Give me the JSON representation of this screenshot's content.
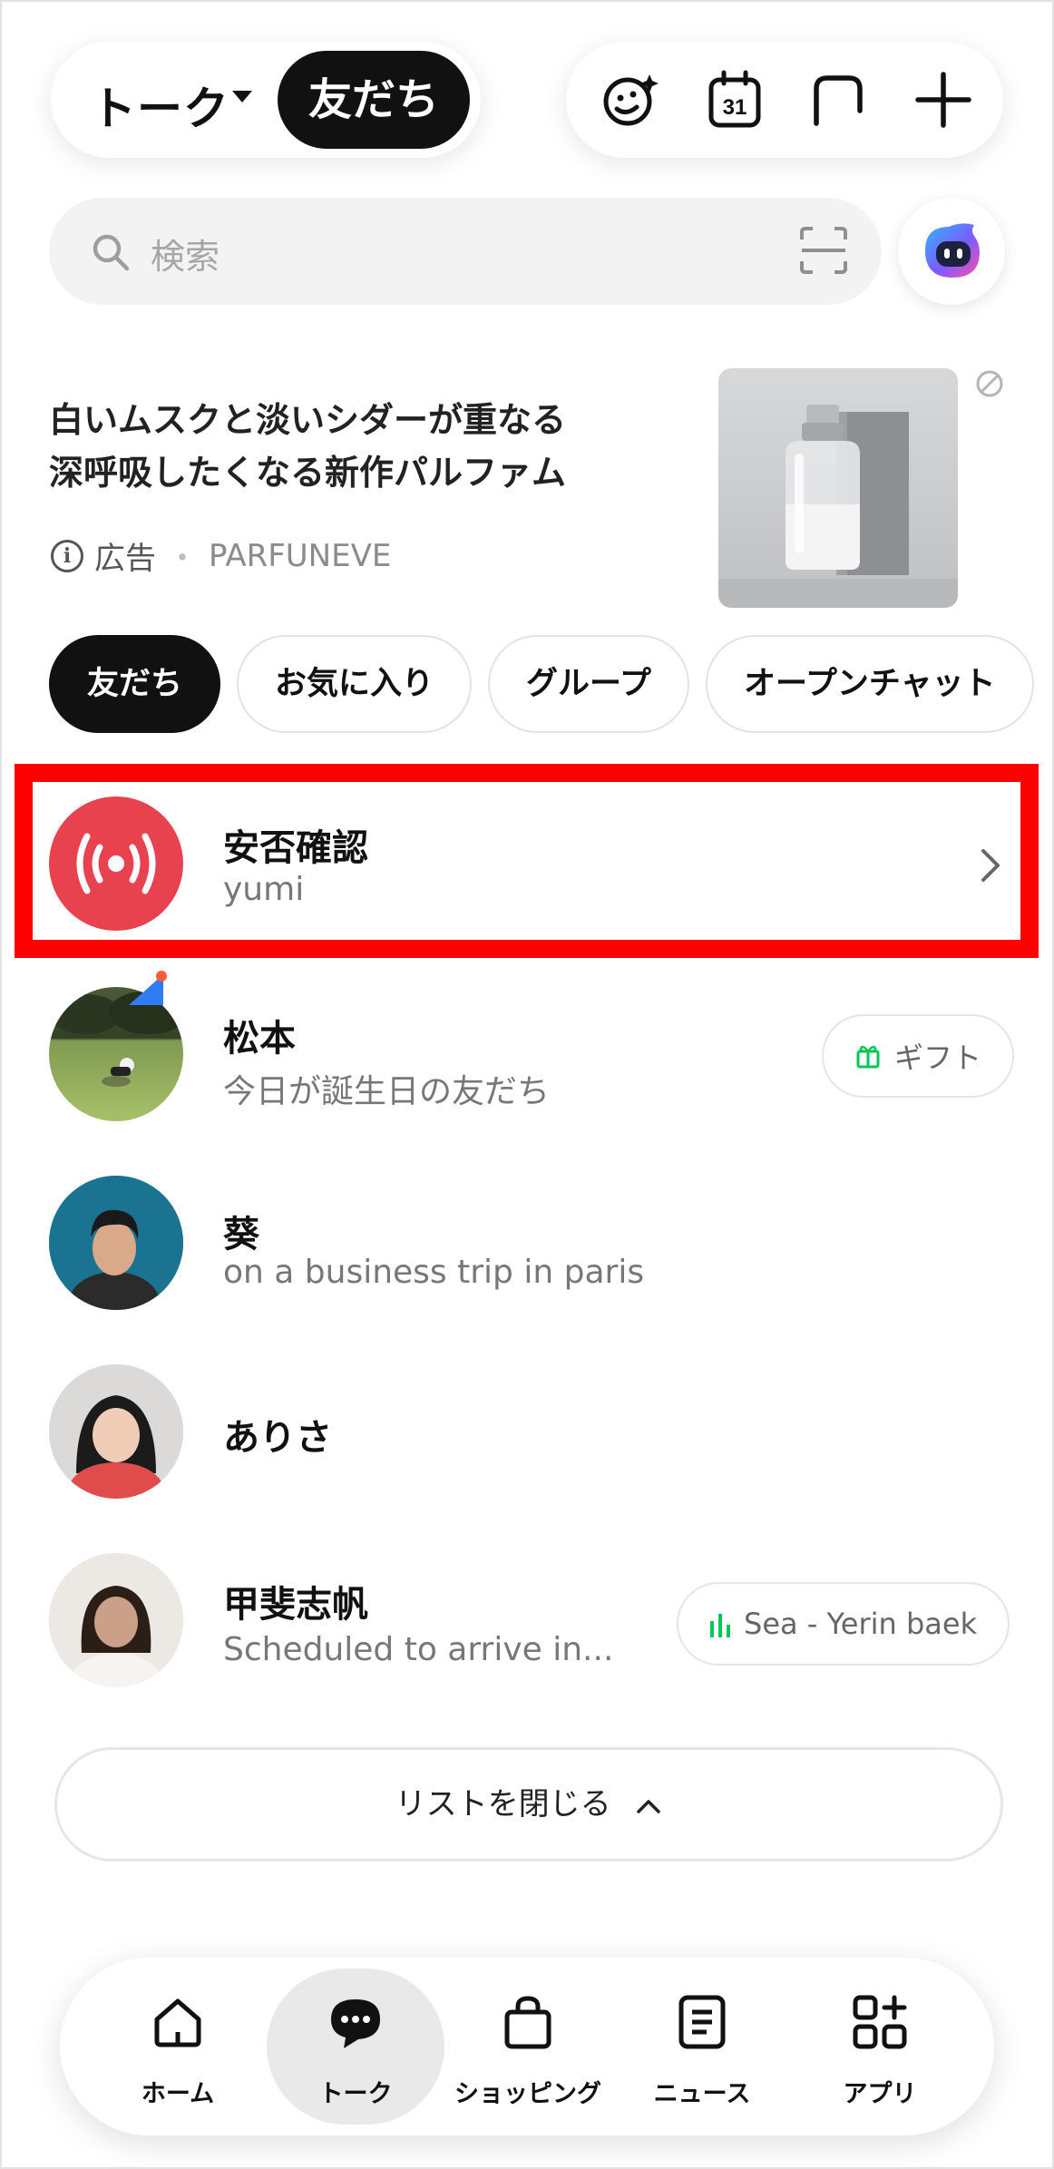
{
  "header": {
    "talk_label": "トーク",
    "friends_label": "友だち",
    "icons": [
      "face-sparkle-icon",
      "calendar-icon",
      "square-icon",
      "plus-icon"
    ],
    "calendar_day": "31"
  },
  "search": {
    "placeholder": "検索",
    "icon": "search-icon",
    "scan_icon": "scan-icon",
    "bot_icon": "ai-bot-icon"
  },
  "ad": {
    "line1": "白いムスクと淡いシダーが重なる",
    "line2": "深呼吸したくなる新作パルファム",
    "label": "広告",
    "separator": "・",
    "advertiser": "PARFUNEVE",
    "info_icon": "i"
  },
  "tabs": [
    {
      "label": "友だち",
      "active": true
    },
    {
      "label": "お気に入り",
      "active": false
    },
    {
      "label": "グループ",
      "active": false
    },
    {
      "label": "オープンチャット",
      "active": false
    }
  ],
  "safety": {
    "title": "安否確認",
    "subtitle": "yumi"
  },
  "friends": [
    {
      "name": "松本",
      "status": "今日が誕生日の友だち",
      "action": "ギフト"
    },
    {
      "name": "葵",
      "status": "on a business trip in paris"
    },
    {
      "name": "ありさ",
      "status": ""
    },
    {
      "name": "甲斐志帆",
      "status": "Scheduled to arrive in...",
      "music": "Sea - Yerin baek"
    }
  ],
  "close_list": {
    "label": "リストを閉じる",
    "icon": "chevron-up-icon"
  },
  "nav": [
    {
      "label": "ホーム",
      "icon": "home-icon",
      "active": false
    },
    {
      "label": "トーク",
      "icon": "chat-bubble-icon",
      "active": true
    },
    {
      "label": "ショッピング",
      "icon": "shopping-bag-icon",
      "active": false
    },
    {
      "label": "ニュース",
      "icon": "news-icon",
      "active": false
    },
    {
      "label": "アプリ",
      "icon": "apps-icon",
      "active": false
    }
  ],
  "colors": {
    "accent_red": "#e8424e",
    "highlight": "#ff0000",
    "line_green": "#06c755",
    "dark": "#111111"
  }
}
